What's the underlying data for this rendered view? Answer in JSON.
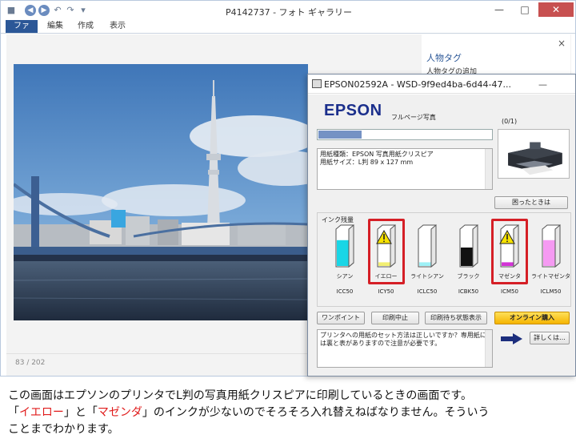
{
  "gallery": {
    "title": "P4142737 - フォト ギャラリー",
    "quick_access": {
      "save": "■",
      "back": "◀",
      "forward": "▶",
      "undo": "↶",
      "redo": "↷",
      "more": "▾"
    },
    "controls": {
      "minimize": "—",
      "maximize": "□",
      "close": "✕"
    },
    "ribbon_tabs": [
      "ファイル",
      "編集",
      "作成",
      "表示"
    ],
    "pane": {
      "close": "×",
      "people_tag": "人物タグ",
      "add_people_tag": "人物タグの追加"
    },
    "pager": "83 / 202"
  },
  "epson": {
    "title": "EPSON02592A - WSD-9f9ed4ba-6d44-47...",
    "minimize": "—",
    "logo": "EPSON",
    "paper_mode": "フルページ写真",
    "page_count": "(0/1)",
    "progress": 0.25,
    "paper_info": [
      "用紙種類：EPSON 写真用紙クリスピア",
      "用紙サイズ：L判 89 x 127 mm"
    ],
    "trouble_button": "困ったときは",
    "ink_section_label": "インク残量",
    "inks": [
      {
        "name": "シアン",
        "code": "ICC50",
        "color": "#19d6e6",
        "level": 0.7,
        "low": false
      },
      {
        "name": "イエロー",
        "code": "ICY50",
        "color": "#f2ef73",
        "level": 0.1,
        "low": true
      },
      {
        "name": "ライトシアン",
        "code": "ICLC50",
        "color": "#9ef1f6",
        "level": 0.1,
        "low": false
      },
      {
        "name": "ブラック",
        "code": "ICBK50",
        "color": "#111111",
        "level": 0.5,
        "low": false
      },
      {
        "name": "マゼンタ",
        "code": "ICM50",
        "color": "#d334d6",
        "level": 0.1,
        "low": true
      },
      {
        "name": "ライトマゼンタ",
        "code": "ICLM50",
        "color": "#f59af2",
        "level": 0.7,
        "low": false
      }
    ],
    "buttons": {
      "one_point": "ワンポイント",
      "cancel": "印刷中止",
      "queue": "印刷待ち状態表示",
      "buy": "オンライン購入",
      "details": "詳しくは..."
    },
    "message": [
      "プリンタへの用紙のセット方法は正しいですか？専用紙に",
      "は裏と表がありますので注意が必要です。"
    ]
  },
  "caption": {
    "line1": "この画面はエプソンのプリンタでL判の写真用紙クリスピアに印刷しているときの画面です。",
    "open1": "「",
    "yellow": "イエロー",
    "mid": "」と「",
    "magenta": "マゼンダ",
    "rest": "」のインクが少ないのでそろそろ入れ替えねばなりません。そういう",
    "line3": "ことまでわかります。"
  }
}
